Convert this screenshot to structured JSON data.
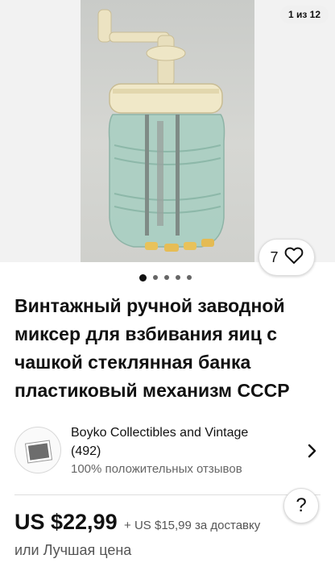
{
  "gallery": {
    "counter": "1 из 12",
    "image_alt": "vintage-egg-beater-glass-jar-photo",
    "dots_total": 5,
    "active_dot": 1
  },
  "watch": {
    "count": "7",
    "icon": "heart-icon"
  },
  "listing": {
    "title": "Винтажный ручной заводной миксер для взбивания яиц с чашкой стеклянная банка пластиковый механизм СССР"
  },
  "seller": {
    "name": "Boyko Collectibles and Vintage",
    "rating": "(492)",
    "feedback": "100% положительных отзывов",
    "icon": "chevron-right-icon"
  },
  "help": {
    "label": "?"
  },
  "pricing": {
    "price": "US $22,99",
    "shipping": "+ US $15,99 за доставку",
    "best_offer": "или Лучшая цена"
  },
  "colors": {
    "text": "#111111",
    "muted": "#555555",
    "divider": "#dedede"
  }
}
